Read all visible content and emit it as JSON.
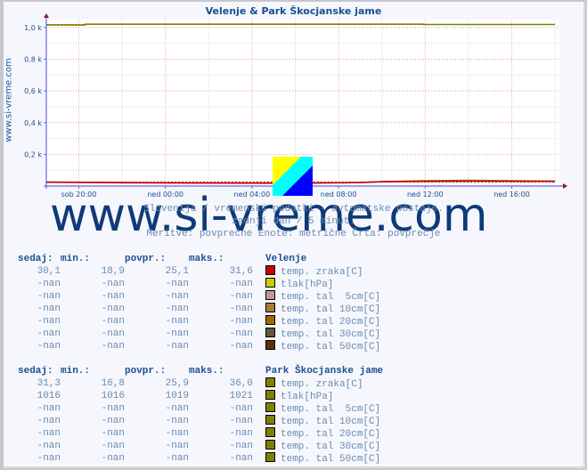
{
  "title": "Velenje & Park Škocjanske jame",
  "side_label": "www.si-vreme.com",
  "watermark": "www.si-vreme.com",
  "subtexts": [
    "Slovenija / vremenski podatki - avtomatske postaje.",
    "zadnji dan / 5 minut.",
    "Meritve: povprečne  Enote: metrične  Črta: povprečje"
  ],
  "chart_data": {
    "type": "line",
    "title": "Velenje & Park Škocjanske jame",
    "xlabel": "",
    "ylabel": "",
    "ylim": [
      0,
      1050
    ],
    "yticks": [
      {
        "value": 200,
        "label": "0,2 k"
      },
      {
        "value": 400,
        "label": "0,4 k"
      },
      {
        "value": 600,
        "label": "0,6 k"
      },
      {
        "value": 800,
        "label": "0,8 k"
      },
      {
        "value": 1000,
        "label": "1,0 k"
      }
    ],
    "xlim_hours": [
      -1.5,
      22.2
    ],
    "xticks": [
      {
        "hour": 0,
        "label": "sob 20:00"
      },
      {
        "hour": 4,
        "label": "ned 00:00"
      },
      {
        "hour": 8,
        "label": "ned 04:00"
      },
      {
        "hour": 12,
        "label": "ned 08:00"
      },
      {
        "hour": 16,
        "label": "ned 12:00"
      },
      {
        "hour": 20,
        "label": "ned 16:00"
      }
    ],
    "grid": true,
    "series": [
      {
        "name": "Park Škocjanske jame tlak[hPa]",
        "color": "#808000",
        "x": [
          -1.5,
          0.3,
          0.3,
          15.9,
          15.9,
          22.0
        ],
        "y": [
          1016,
          1016,
          1021,
          1021,
          1019,
          1019
        ]
      },
      {
        "name": "Park Škocjanske jame tlak povprečje",
        "color": "#808000",
        "dashed": true,
        "x": [
          -1.5,
          22.0
        ],
        "y": [
          1019,
          1019
        ]
      },
      {
        "name": "Park Škocjanske jame temp. zraka[C]",
        "color": "#808000",
        "x": [
          -1.5,
          2,
          6,
          10,
          13,
          14,
          16,
          18,
          22
        ],
        "y": [
          25,
          22,
          19,
          17,
          22,
          28,
          33,
          36,
          31
        ]
      },
      {
        "name": "Velenje temp. zraka[C]",
        "color": "#cc0000",
        "x": [
          -1.5,
          2,
          6,
          10,
          13,
          14,
          16,
          18,
          22
        ],
        "y": [
          24,
          21,
          19,
          19,
          22,
          27,
          30,
          31,
          30
        ]
      },
      {
        "name": "Velenje temp. zraka povprečje",
        "color": "#cc0000",
        "dashed": true,
        "x": [
          -1.5,
          22.0
        ],
        "y": [
          25.1,
          25.1
        ]
      }
    ]
  },
  "stats": {
    "headers": [
      "sedaj:",
      "min.:",
      "povpr.:",
      "maks.:"
    ],
    "stations": [
      {
        "name": "Velenje",
        "rows": [
          {
            "values": [
              "30,1",
              "18,9",
              "25,1",
              "31,6"
            ],
            "label": "temp. zraka[C]",
            "color": "#cc0000"
          },
          {
            "values": [
              "-nan",
              "-nan",
              "-nan",
              "-nan"
            ],
            "label": "tlak[hPa]",
            "color": "#cccc00"
          },
          {
            "values": [
              "-nan",
              "-nan",
              "-nan",
              "-nan"
            ],
            "label": "temp. tal  5cm[C]",
            "color": "#c09898"
          },
          {
            "values": [
              "-nan",
              "-nan",
              "-nan",
              "-nan"
            ],
            "label": "temp. tal 10cm[C]",
            "color": "#b07838"
          },
          {
            "values": [
              "-nan",
              "-nan",
              "-nan",
              "-nan"
            ],
            "label": "temp. tal 20cm[C]",
            "color": "#a06800"
          },
          {
            "values": [
              "-nan",
              "-nan",
              "-nan",
              "-nan"
            ],
            "label": "temp. tal 30cm[C]",
            "color": "#605838"
          },
          {
            "values": [
              "-nan",
              "-nan",
              "-nan",
              "-nan"
            ],
            "label": "temp. tal 50cm[C]",
            "color": "#603000"
          }
        ]
      },
      {
        "name": "Park Škocjanske jame",
        "rows": [
          {
            "values": [
              "31,3",
              "16,8",
              "25,9",
              "36,0"
            ],
            "label": "temp. zraka[C]",
            "color": "#808000"
          },
          {
            "values": [
              "1016",
              "1016",
              "1019",
              "1021"
            ],
            "label": "tlak[hPa]",
            "color": "#808000"
          },
          {
            "values": [
              "-nan",
              "-nan",
              "-nan",
              "-nan"
            ],
            "label": "temp. tal  5cm[C]",
            "color": "#808000"
          },
          {
            "values": [
              "-nan",
              "-nan",
              "-nan",
              "-nan"
            ],
            "label": "temp. tal 10cm[C]",
            "color": "#808000"
          },
          {
            "values": [
              "-nan",
              "-nan",
              "-nan",
              "-nan"
            ],
            "label": "temp. tal 20cm[C]",
            "color": "#808000"
          },
          {
            "values": [
              "-nan",
              "-nan",
              "-nan",
              "-nan"
            ],
            "label": "temp. tal 30cm[C]",
            "color": "#808000"
          },
          {
            "values": [
              "-nan",
              "-nan",
              "-nan",
              "-nan"
            ],
            "label": "temp. tal 50cm[C]",
            "color": "#808000"
          }
        ]
      }
    ]
  }
}
